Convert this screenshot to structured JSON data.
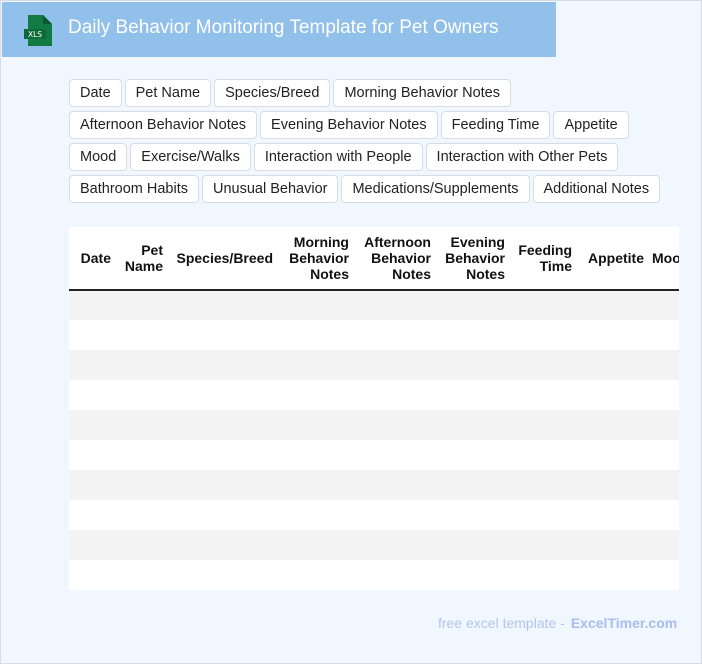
{
  "header": {
    "title": "Daily Behavior Monitoring Template for Pet Owners",
    "icon": "xls-file-icon",
    "icon_text": "XLS"
  },
  "tags": [
    "Date",
    "Pet Name",
    "Species/Breed",
    "Morning Behavior Notes",
    "Afternoon Behavior Notes",
    "Evening Behavior Notes",
    "Feeding Time",
    "Appetite",
    "Mood",
    "Exercise/Walks",
    "Interaction with People",
    "Interaction with Other Pets",
    "Bathroom Habits",
    "Unusual Behavior",
    "Medications/Supplements",
    "Additional Notes"
  ],
  "table": {
    "columns": [
      "Date",
      "Pet Name",
      "Species/Breed",
      "Morning Behavior Notes",
      "Afternoon Behavior Notes",
      "Evening Behavior Notes",
      "Feeding Time",
      "Appetite",
      "Mood"
    ]
  },
  "footer": {
    "text": "free excel template -",
    "brand": "ExcelTimer.com"
  },
  "colors": {
    "header": "#91c0ea",
    "background": "#f0f7ff",
    "row_alt": "#f3f3f3"
  }
}
